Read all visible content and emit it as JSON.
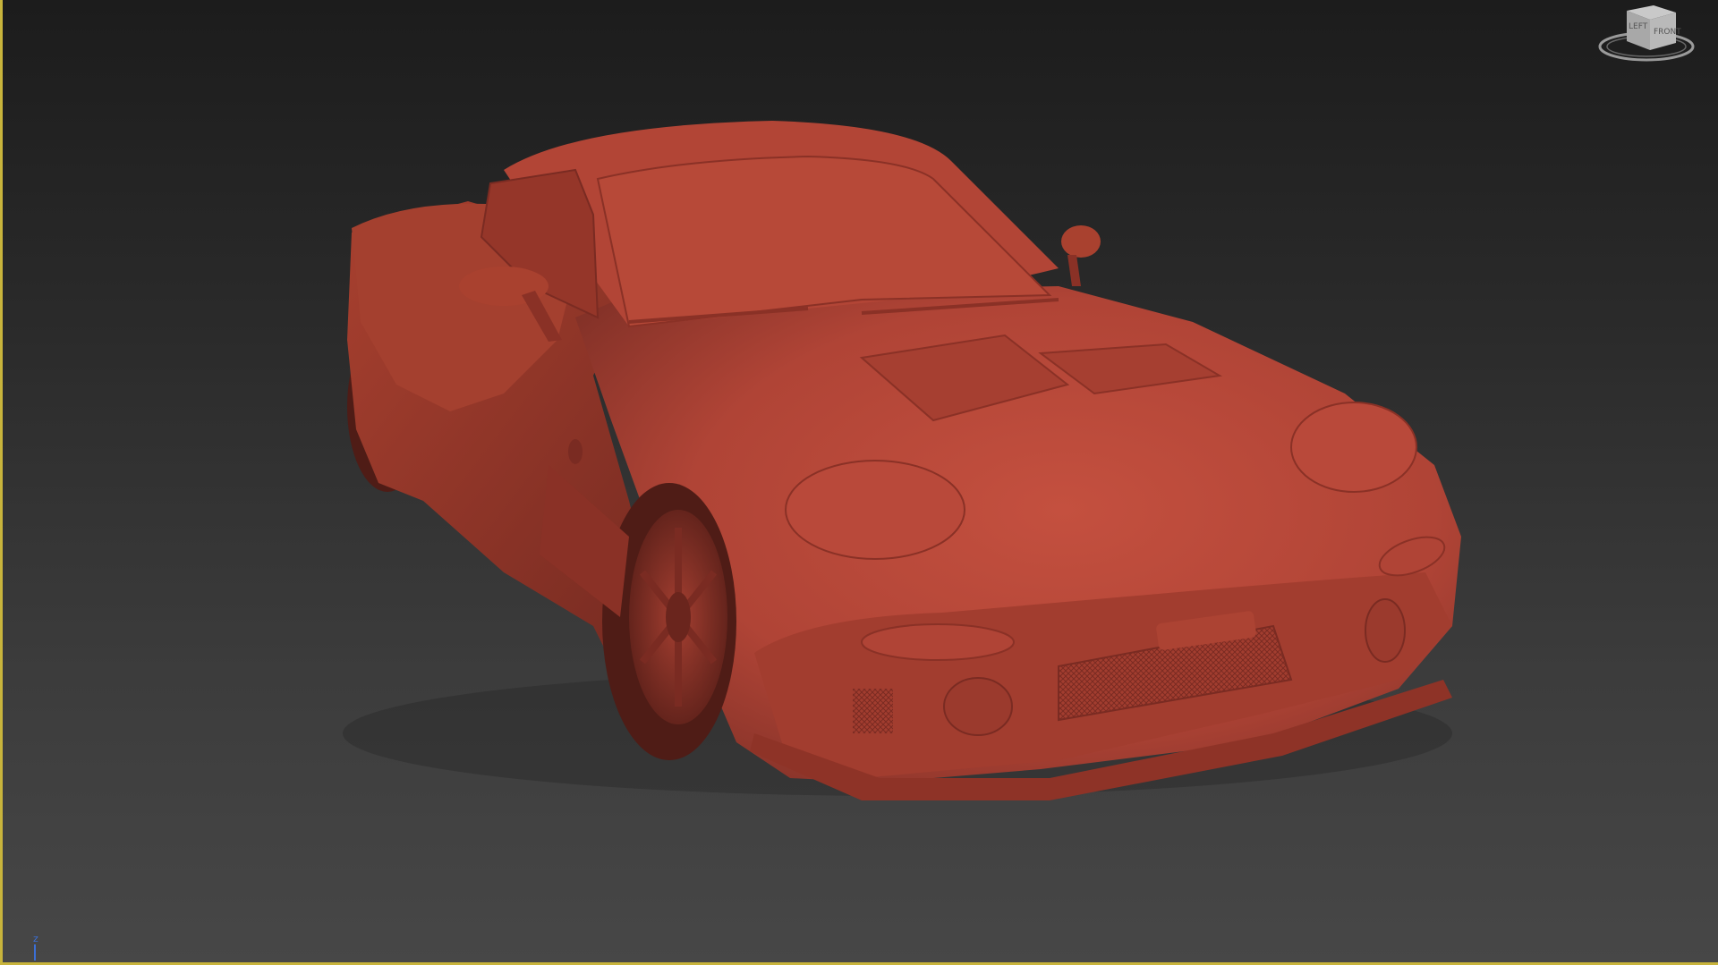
{
  "viewport": {
    "active_border_color": "#c8b43c",
    "background_top": "#1c1c1c",
    "background_bottom": "#474747",
    "model_color": "#b8483a",
    "model_name_icon": "car-model"
  },
  "viewcube": {
    "face_front_label": "FRONT",
    "face_left_label": "LEFT"
  },
  "axis": {
    "z_label": "z"
  }
}
